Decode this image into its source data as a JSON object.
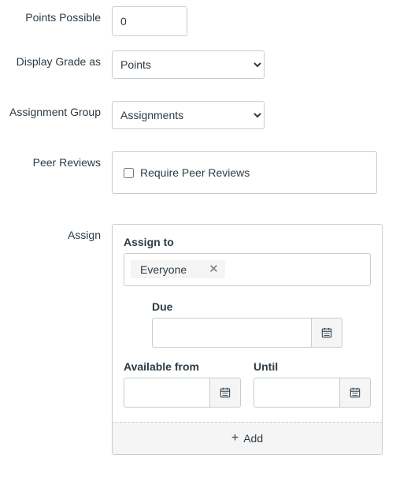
{
  "points": {
    "label": "Points Possible",
    "value": "0"
  },
  "displayGrade": {
    "label": "Display Grade as",
    "value": "Points",
    "options": [
      "Points"
    ]
  },
  "assignmentGroup": {
    "label": "Assignment Group",
    "value": "Assignments",
    "options": [
      "Assignments"
    ]
  },
  "peerReviews": {
    "label": "Peer Reviews",
    "checkboxLabel": "Require Peer Reviews"
  },
  "assign": {
    "label": "Assign",
    "assignTo": {
      "label": "Assign to",
      "tokens": [
        "Everyone"
      ]
    },
    "due": {
      "label": "Due",
      "value": ""
    },
    "availableFrom": {
      "label": "Available from",
      "value": ""
    },
    "until": {
      "label": "Until",
      "value": ""
    },
    "addLabel": "Add"
  }
}
